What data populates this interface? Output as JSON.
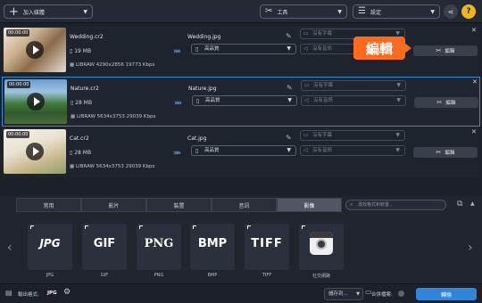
{
  "toolbar": {
    "add_media_label": "加入媒體",
    "tools_label": "工具",
    "settings_label": "設定"
  },
  "files": [
    {
      "timecode": "00:00:00",
      "name": "Wedding.cr2",
      "size": "19 MB",
      "meta": "LIBRAW 4290x2856 19773 Kbps",
      "output": "Wedding.jpg",
      "quality": "高品質",
      "subtitle": "沒有字幕",
      "audio": "沒有音訊",
      "edit_label": "編輯"
    },
    {
      "timecode": "00:00:00",
      "name": "Nature.cr2",
      "size": "28 MB",
      "meta": "LIBRAW 5634x3753 29039 Kbps",
      "output": "Nature.jpg",
      "quality": "高品質",
      "subtitle": "沒有字幕",
      "audio": "沒有音訊",
      "edit_label": "編輯"
    },
    {
      "timecode": "00:00:00",
      "name": "Cat.cr2",
      "size": "28 MB",
      "meta": "LIBRAW 5634x3753 29039 Kbps",
      "output": "Cat.jpg",
      "quality": "高品質",
      "subtitle": "沒有字幕",
      "audio": "沒有音訊",
      "edit_label": "編輯"
    }
  ],
  "tooltip": "編輯",
  "tabs": [
    "常用",
    "影片",
    "裝置",
    "音訊",
    "影像"
  ],
  "active_tab": "影像",
  "search_placeholder": "尋找格式和裝置...",
  "formats": [
    {
      "logo": "JPG",
      "label": "JPG"
    },
    {
      "logo": "GIF",
      "label": "GIF"
    },
    {
      "logo": "PNG",
      "label": "PNG"
    },
    {
      "logo": "BMP",
      "label": "BMP"
    },
    {
      "logo": "TIFF",
      "label": "TIFF"
    },
    {
      "logo": "",
      "label": "社交網路"
    }
  ],
  "footer": {
    "output_format_label": "輸出格式:",
    "output_format_value": "JPG",
    "save_to_label": "儲存到...",
    "merge_label": "合併檔案:",
    "convert_label": "轉換"
  },
  "colors": {
    "accent": "#2f86d8",
    "tooltip": "#ff6a1e",
    "background": "#1b2029"
  }
}
